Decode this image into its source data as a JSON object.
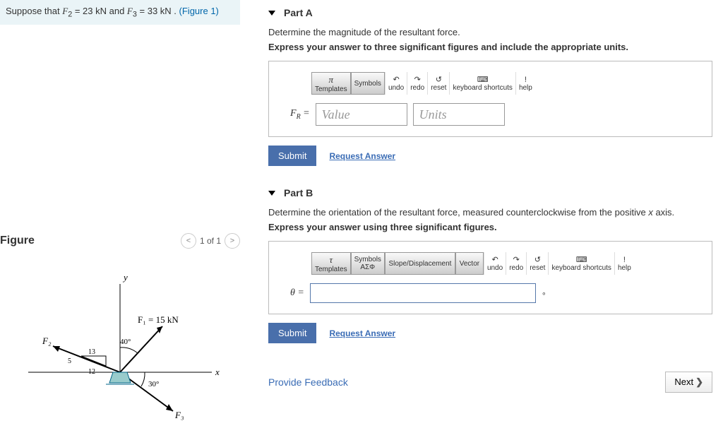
{
  "suppose": {
    "prefix": "Suppose that ",
    "f2_label": "F",
    "f2_sub": "2",
    "f2_eq": " = 23  kN and ",
    "f3_label": "F",
    "f3_sub": "3",
    "f3_eq": " = 33  kN . ",
    "link": "(Figure 1)"
  },
  "figure": {
    "title": "Figure",
    "counter": "1 of 1",
    "y_label": "y",
    "x_label": "x",
    "F1_label": "F₁ = 15 kN",
    "ang40": "40°",
    "ang30": "30°",
    "F2_label": "F₂",
    "F3_label": "F₃",
    "n5": "5",
    "n12": "12",
    "n13": "13"
  },
  "partA": {
    "title": "Part A",
    "desc": "Determine the magnitude of the resultant force.",
    "bold": "Express your answer to three significant figures and include the appropriate units.",
    "fr_label": "F",
    "fr_sub": "R",
    "eq": " =",
    "val_ph": "Value",
    "unit_ph": "Units",
    "submit": "Submit",
    "req": "Request Answer",
    "tool": {
      "templates": "Templates",
      "tpl_sym": "π",
      "symbols": "Symbols",
      "undo": "undo",
      "redo": "redo",
      "reset": "reset",
      "kb": "keyboard shortcuts",
      "help": "help"
    }
  },
  "partB": {
    "title": "Part B",
    "desc": "Determine the orientation of the resultant force, measured counterclockwise from the positive x axis.",
    "bold": "Express your answer using three significant figures.",
    "theta": "θ",
    "eq": " =",
    "deg": "∘",
    "submit": "Submit",
    "req": "Request Answer",
    "tool": {
      "templates": "Templates",
      "tpl_sym": "τ",
      "symbols": "Symbols",
      "sym_sub": "ΑΣΦ",
      "slope": "Slope/Displacement",
      "vector": "Vector",
      "undo": "undo",
      "redo": "redo",
      "reset": "reset",
      "kb": "keyboard shortcuts",
      "help": "help"
    }
  },
  "footer": {
    "provide": "Provide Feedback",
    "next": "Next",
    "arrow": "❯"
  }
}
